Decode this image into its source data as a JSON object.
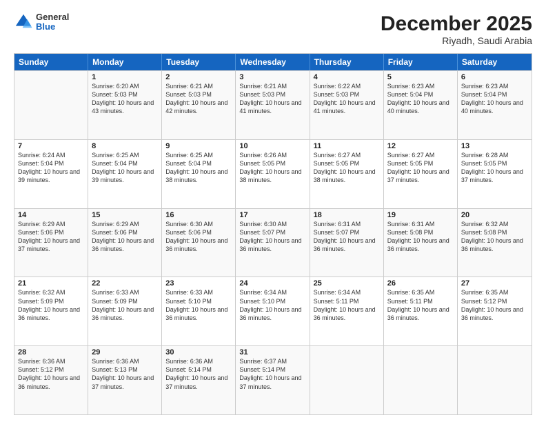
{
  "logo": {
    "general": "General",
    "blue": "Blue"
  },
  "title": "December 2025",
  "location": "Riyadh, Saudi Arabia",
  "days_of_week": [
    "Sunday",
    "Monday",
    "Tuesday",
    "Wednesday",
    "Thursday",
    "Friday",
    "Saturday"
  ],
  "weeks": [
    [
      {
        "day": "",
        "sunrise": "",
        "sunset": "",
        "daylight": ""
      },
      {
        "day": "1",
        "sunrise": "Sunrise: 6:20 AM",
        "sunset": "Sunset: 5:03 PM",
        "daylight": "Daylight: 10 hours and 43 minutes."
      },
      {
        "day": "2",
        "sunrise": "Sunrise: 6:21 AM",
        "sunset": "Sunset: 5:03 PM",
        "daylight": "Daylight: 10 hours and 42 minutes."
      },
      {
        "day": "3",
        "sunrise": "Sunrise: 6:21 AM",
        "sunset": "Sunset: 5:03 PM",
        "daylight": "Daylight: 10 hours and 41 minutes."
      },
      {
        "day": "4",
        "sunrise": "Sunrise: 6:22 AM",
        "sunset": "Sunset: 5:03 PM",
        "daylight": "Daylight: 10 hours and 41 minutes."
      },
      {
        "day": "5",
        "sunrise": "Sunrise: 6:23 AM",
        "sunset": "Sunset: 5:04 PM",
        "daylight": "Daylight: 10 hours and 40 minutes."
      },
      {
        "day": "6",
        "sunrise": "Sunrise: 6:23 AM",
        "sunset": "Sunset: 5:04 PM",
        "daylight": "Daylight: 10 hours and 40 minutes."
      }
    ],
    [
      {
        "day": "7",
        "sunrise": "Sunrise: 6:24 AM",
        "sunset": "Sunset: 5:04 PM",
        "daylight": "Daylight: 10 hours and 39 minutes."
      },
      {
        "day": "8",
        "sunrise": "Sunrise: 6:25 AM",
        "sunset": "Sunset: 5:04 PM",
        "daylight": "Daylight: 10 hours and 39 minutes."
      },
      {
        "day": "9",
        "sunrise": "Sunrise: 6:25 AM",
        "sunset": "Sunset: 5:04 PM",
        "daylight": "Daylight: 10 hours and 38 minutes."
      },
      {
        "day": "10",
        "sunrise": "Sunrise: 6:26 AM",
        "sunset": "Sunset: 5:05 PM",
        "daylight": "Daylight: 10 hours and 38 minutes."
      },
      {
        "day": "11",
        "sunrise": "Sunrise: 6:27 AM",
        "sunset": "Sunset: 5:05 PM",
        "daylight": "Daylight: 10 hours and 38 minutes."
      },
      {
        "day": "12",
        "sunrise": "Sunrise: 6:27 AM",
        "sunset": "Sunset: 5:05 PM",
        "daylight": "Daylight: 10 hours and 37 minutes."
      },
      {
        "day": "13",
        "sunrise": "Sunrise: 6:28 AM",
        "sunset": "Sunset: 5:05 PM",
        "daylight": "Daylight: 10 hours and 37 minutes."
      }
    ],
    [
      {
        "day": "14",
        "sunrise": "Sunrise: 6:29 AM",
        "sunset": "Sunset: 5:06 PM",
        "daylight": "Daylight: 10 hours and 37 minutes."
      },
      {
        "day": "15",
        "sunrise": "Sunrise: 6:29 AM",
        "sunset": "Sunset: 5:06 PM",
        "daylight": "Daylight: 10 hours and 36 minutes."
      },
      {
        "day": "16",
        "sunrise": "Sunrise: 6:30 AM",
        "sunset": "Sunset: 5:06 PM",
        "daylight": "Daylight: 10 hours and 36 minutes."
      },
      {
        "day": "17",
        "sunrise": "Sunrise: 6:30 AM",
        "sunset": "Sunset: 5:07 PM",
        "daylight": "Daylight: 10 hours and 36 minutes."
      },
      {
        "day": "18",
        "sunrise": "Sunrise: 6:31 AM",
        "sunset": "Sunset: 5:07 PM",
        "daylight": "Daylight: 10 hours and 36 minutes."
      },
      {
        "day": "19",
        "sunrise": "Sunrise: 6:31 AM",
        "sunset": "Sunset: 5:08 PM",
        "daylight": "Daylight: 10 hours and 36 minutes."
      },
      {
        "day": "20",
        "sunrise": "Sunrise: 6:32 AM",
        "sunset": "Sunset: 5:08 PM",
        "daylight": "Daylight: 10 hours and 36 minutes."
      }
    ],
    [
      {
        "day": "21",
        "sunrise": "Sunrise: 6:32 AM",
        "sunset": "Sunset: 5:09 PM",
        "daylight": "Daylight: 10 hours and 36 minutes."
      },
      {
        "day": "22",
        "sunrise": "Sunrise: 6:33 AM",
        "sunset": "Sunset: 5:09 PM",
        "daylight": "Daylight: 10 hours and 36 minutes."
      },
      {
        "day": "23",
        "sunrise": "Sunrise: 6:33 AM",
        "sunset": "Sunset: 5:10 PM",
        "daylight": "Daylight: 10 hours and 36 minutes."
      },
      {
        "day": "24",
        "sunrise": "Sunrise: 6:34 AM",
        "sunset": "Sunset: 5:10 PM",
        "daylight": "Daylight: 10 hours and 36 minutes."
      },
      {
        "day": "25",
        "sunrise": "Sunrise: 6:34 AM",
        "sunset": "Sunset: 5:11 PM",
        "daylight": "Daylight: 10 hours and 36 minutes."
      },
      {
        "day": "26",
        "sunrise": "Sunrise: 6:35 AM",
        "sunset": "Sunset: 5:11 PM",
        "daylight": "Daylight: 10 hours and 36 minutes."
      },
      {
        "day": "27",
        "sunrise": "Sunrise: 6:35 AM",
        "sunset": "Sunset: 5:12 PM",
        "daylight": "Daylight: 10 hours and 36 minutes."
      }
    ],
    [
      {
        "day": "28",
        "sunrise": "Sunrise: 6:36 AM",
        "sunset": "Sunset: 5:12 PM",
        "daylight": "Daylight: 10 hours and 36 minutes."
      },
      {
        "day": "29",
        "sunrise": "Sunrise: 6:36 AM",
        "sunset": "Sunset: 5:13 PM",
        "daylight": "Daylight: 10 hours and 37 minutes."
      },
      {
        "day": "30",
        "sunrise": "Sunrise: 6:36 AM",
        "sunset": "Sunset: 5:14 PM",
        "daylight": "Daylight: 10 hours and 37 minutes."
      },
      {
        "day": "31",
        "sunrise": "Sunrise: 6:37 AM",
        "sunset": "Sunset: 5:14 PM",
        "daylight": "Daylight: 10 hours and 37 minutes."
      },
      {
        "day": "",
        "sunrise": "",
        "sunset": "",
        "daylight": ""
      },
      {
        "day": "",
        "sunrise": "",
        "sunset": "",
        "daylight": ""
      },
      {
        "day": "",
        "sunrise": "",
        "sunset": "",
        "daylight": ""
      }
    ]
  ]
}
